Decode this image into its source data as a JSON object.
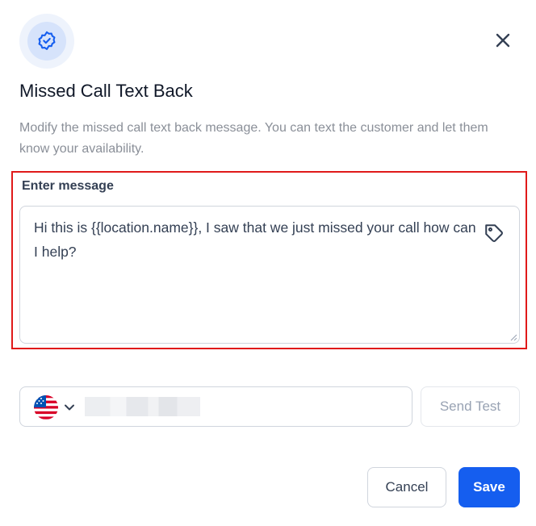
{
  "header": {
    "icon": "badge-check-icon",
    "close_icon": "close-icon"
  },
  "dialog": {
    "title": "Missed Call Text Back",
    "description": "Modify the missed call text back message. You can text the customer and let them know your availability."
  },
  "message_field": {
    "label": "Enter message",
    "value": "Hi this is {{location.name}}, I saw that we just missed your call how can I help?",
    "tag_icon": "tag-icon"
  },
  "phone": {
    "country_flag_icon": "us-flag-icon",
    "dropdown_icon": "chevron-down-icon",
    "send_test_label": "Send Test"
  },
  "footer": {
    "cancel_label": "Cancel",
    "save_label": "Save"
  },
  "colors": {
    "primary": "#155eef",
    "highlight_border": "#e01a1a",
    "badge_bg": "#eef3fc"
  }
}
